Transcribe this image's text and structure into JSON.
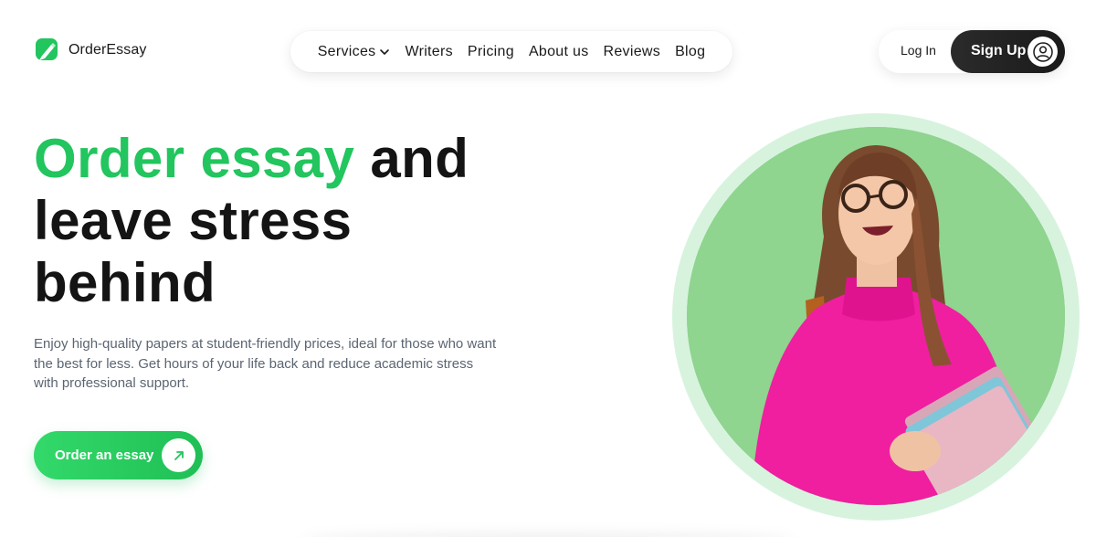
{
  "brand": {
    "name": "OrderEssay",
    "accent": "#22c55e"
  },
  "nav": {
    "items": [
      {
        "label": "Services",
        "has_dropdown": true,
        "icon": "chevron-down-icon"
      },
      {
        "label": "Writers"
      },
      {
        "label": "Pricing"
      },
      {
        "label": "About us"
      },
      {
        "label": "Reviews"
      },
      {
        "label": "Blog"
      }
    ]
  },
  "auth": {
    "login_label": "Log In",
    "signup_label": "Sign Up",
    "user_icon": "user-icon"
  },
  "hero": {
    "headline_green": "Order essay",
    "headline_rest_1": " and",
    "headline_line_2": "leave stress",
    "headline_line_3": "behind",
    "subtitle": "Enjoy high-quality papers at student-friendly prices, ideal for those who want the best for less. Get hours of your life back and reduce academic stress with professional support.",
    "cta_label": "Order an essay",
    "cta_icon": "arrow-up-right-icon",
    "image": "smiling-student-with-books"
  }
}
